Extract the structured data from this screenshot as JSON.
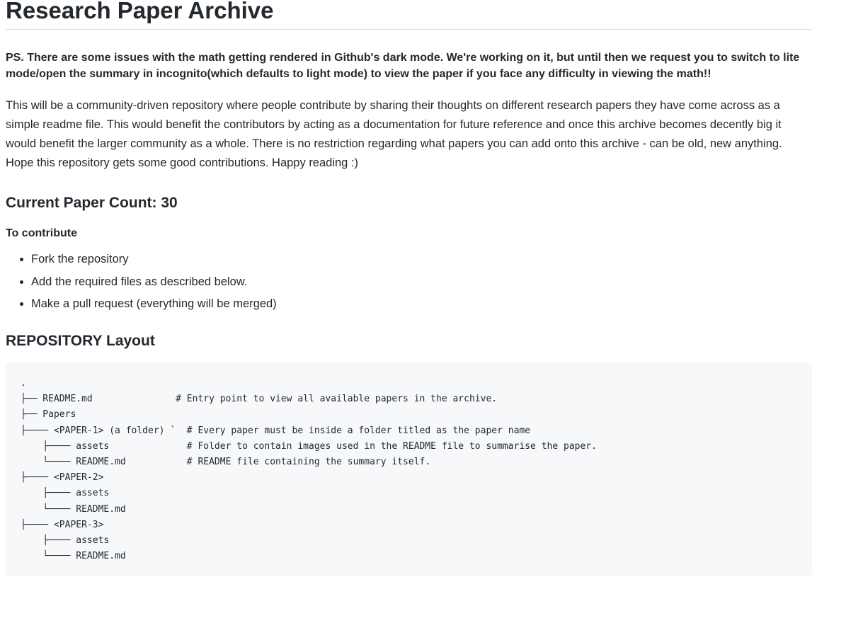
{
  "title": "Research Paper Archive",
  "ps_note": "PS. There are some issues with the math getting rendered in Github's dark mode. We're working on it, but until then we request you to switch to lite mode/open the summary in incognito(which defaults to light mode) to view the paper if you face any difficulty in viewing the math!!",
  "intro": "This will be a community-driven repository where people contribute by sharing their thoughts on different research papers they have come across as a simple readme file. This would benefit the contributors by acting as a documentation for future reference and once this archive becomes decently big it would benefit the larger community as a whole. There is no restriction regarding what papers you can add onto this archive - can be old, new anything. Hope this repository gets some good contributions. Happy reading :)",
  "paper_count_heading": "Current Paper Count: 30",
  "contribute_heading": "To contribute",
  "contribute_steps": [
    "Fork the repository",
    "Add the required files as described below.",
    "Make a pull request (everything will be merged)"
  ],
  "layout_heading": "REPOSITORY Layout",
  "layout_code": ".\n├── README.md               # Entry point to view all available papers in the archive.\n├── Papers\n├──── <PAPER-1> (a folder) `  # Every paper must be inside a folder titled as the paper name\n    ├──── assets              # Folder to contain images used in the README file to summarise the paper.\n    └──── README.md           # README file containing the summary itself.\n├──── <PAPER-2>\n    ├──── assets\n    └──── README.md\n├──── <PAPER-3>\n    ├──── assets\n    └──── README.md"
}
